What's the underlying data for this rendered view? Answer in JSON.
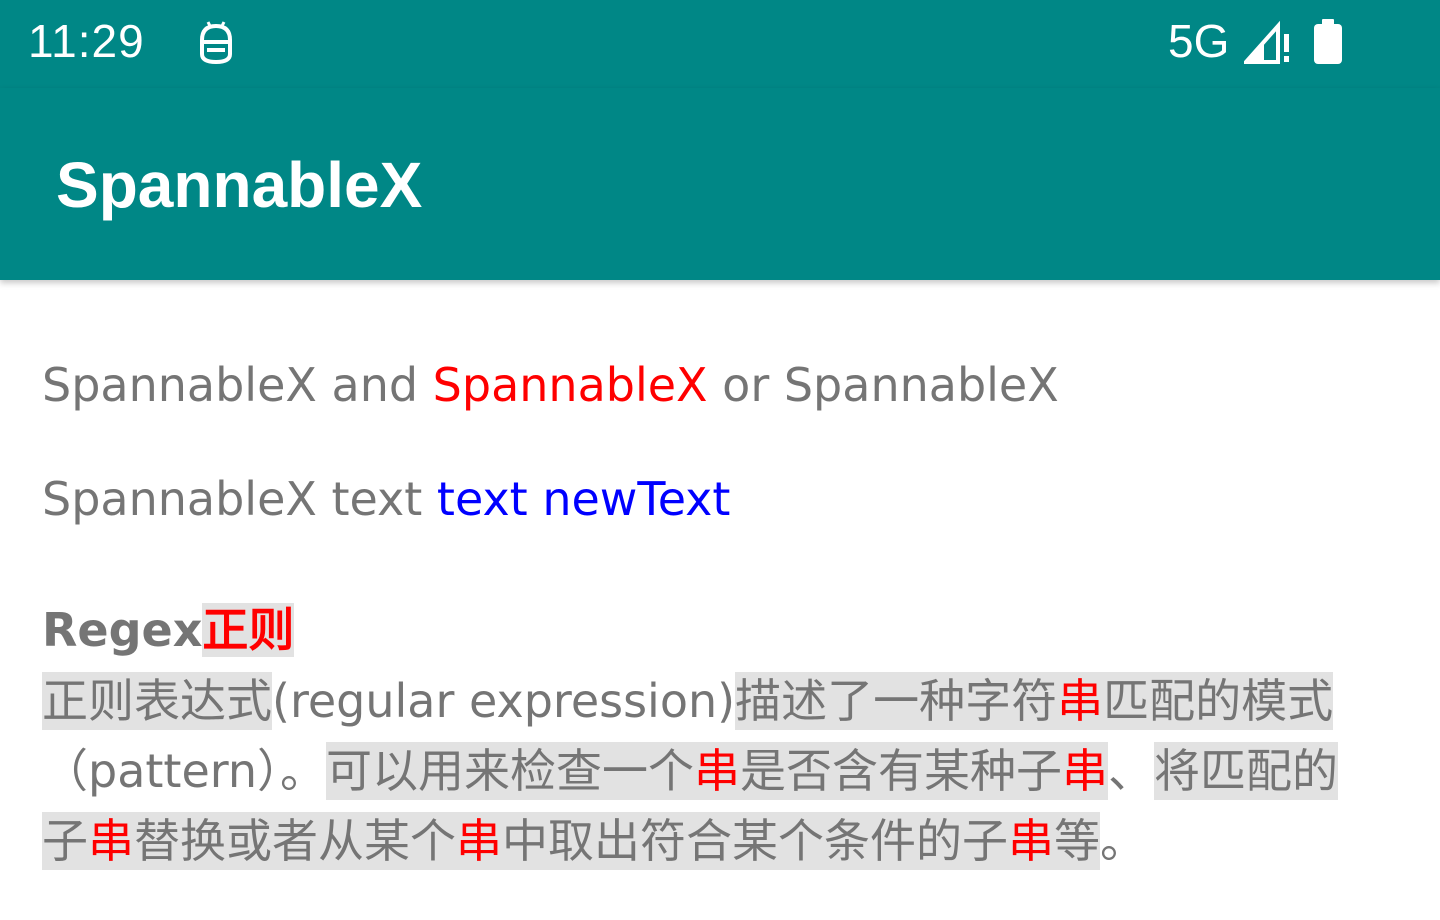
{
  "status_bar": {
    "time": "11:29",
    "notification_icon": "android-debug-icon",
    "network": "5G",
    "signal_icon": "signal-alert-icon",
    "battery_icon": "battery-full-icon"
  },
  "app_bar": {
    "title": "SpannableX"
  },
  "line1": {
    "part1": "SpannableX and ",
    "part2": "SpannableX",
    "part3": " or SpannableX"
  },
  "line2": {
    "part1": "SpannableX text ",
    "part2": "text newText"
  },
  "regex": {
    "title_part1": "Regex",
    "title_part2": "正则",
    "para_segments": [
      "正则表达式",
      "(regular expression)",
      "描述了一种字符",
      "串",
      "匹配的模式",
      "（pattern）。",
      "可以用来检查一个",
      "串",
      "是否含有某种子",
      "串",
      "、",
      "将匹配的子",
      "串",
      "替换或者从某个",
      "串",
      "中取出符合某个条件的子",
      "串",
      "等",
      "。"
    ]
  },
  "colors": {
    "primary": "#008786",
    "text_gray": "#757575",
    "highlight_red": "#ff0000",
    "highlight_blue": "#0000ff",
    "highlight_bg": "#e2e2e2"
  }
}
